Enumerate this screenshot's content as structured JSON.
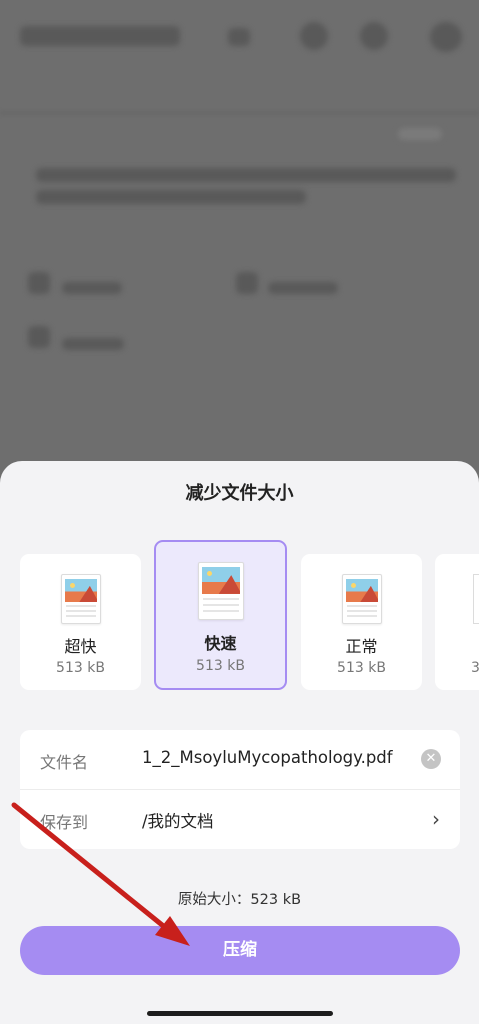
{
  "sheet": {
    "title": "减少文件大小",
    "options": [
      {
        "label": "超快",
        "size": "513 kB"
      },
      {
        "label": "快速",
        "size": "513 kB",
        "selected": true
      },
      {
        "label": "正常",
        "size": "513 kB"
      },
      {
        "label": "",
        "size": "3"
      }
    ],
    "form": {
      "filename_label": "文件名",
      "filename_value": "1_2_MsoyluMycopathology.pdf",
      "saveto_label": "保存到",
      "saveto_value": "/我的文档"
    },
    "original_size": "原始大小：523 kB",
    "compress_label": "压缩"
  },
  "colors": {
    "accent": "#a58cf2",
    "selected_bg": "#ece9fc",
    "annotation_arrow": "#c8201c"
  },
  "icons": {
    "clear": "close-circle-icon",
    "chevron": "chevron-right-icon",
    "document": "document-thumbnail-icon"
  }
}
